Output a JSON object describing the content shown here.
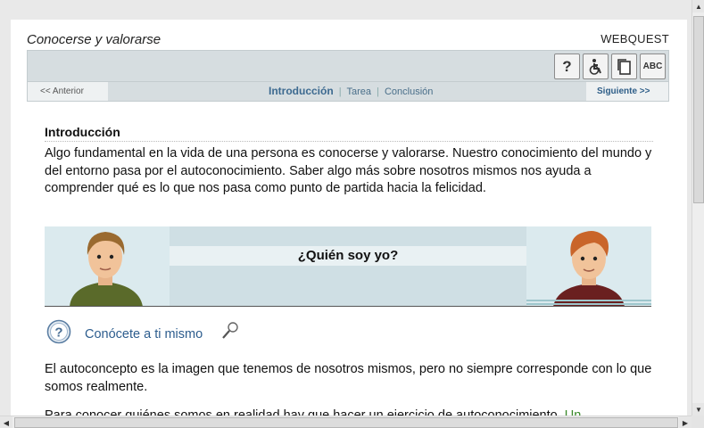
{
  "header": {
    "title": "Conocerse y valorarse",
    "type_label": "WEBQUEST"
  },
  "toolbar": {
    "help_label": "?",
    "abc_label": "ABC"
  },
  "nav": {
    "prev_label": "<< Anterior",
    "current": "Introducción",
    "separator": "|",
    "tarea": "Tarea",
    "conclusion": "Conclusión",
    "next_label": "Siguiente >>"
  },
  "content": {
    "heading": "Introducción",
    "intro": "Algo fundamental en la vida de una persona es conocerse y valorarse. Nuestro conocimiento del mundo y del entorno pasa por el autoconocimiento. Saber algo más sobre nosotros mismos nos ayuda a comprender qué es lo que nos pasa como punto de partida hacia la felicidad.",
    "banner_title": "¿Quién soy yo?",
    "help_glyph": "?",
    "know_link": "Conócete a ti mismo",
    "paragraph2": "El autoconcepto es la imagen que tenemos de nosotros mismos, pero no siempre corresponde con lo que somos realmente.",
    "paragraph3": "Para conocer quiénes somos en realidad hay que hacer un ejercicio de autoconocimiento.",
    "paragraph3_link": "Un"
  },
  "scrollbars": {
    "up": "▲",
    "down": "▼",
    "left": "◀",
    "right": "▶"
  },
  "colors": {
    "toolbar_bg": "#d6dde0",
    "link": "#2d5d8e",
    "banner_bg": "#cfdfe4"
  }
}
